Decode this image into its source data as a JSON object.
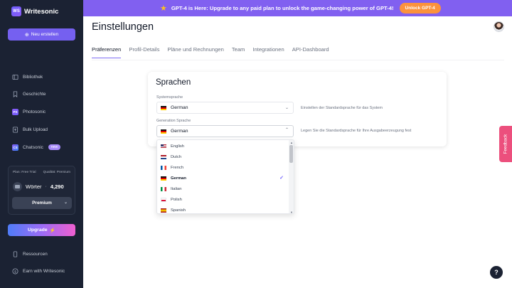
{
  "app": {
    "name": "Writesonic",
    "logo_text": "WS"
  },
  "sidebar": {
    "new_button": "Neu erstellen",
    "items": [
      {
        "label": "Bibliothek",
        "icon": "library-icon"
      },
      {
        "label": "Geschichte",
        "icon": "bookmark-icon"
      },
      {
        "label": "Photosonic",
        "icon": "photosonic-icon"
      },
      {
        "label": "Bulk Upload",
        "icon": "upload-icon"
      },
      {
        "label": "Chatsonic",
        "icon": "chatsonic-icon",
        "badge": "new"
      }
    ],
    "plan": {
      "plan_label": "Plan: Free Trial",
      "quality_label": "Qualität: Premium",
      "words_label": "Wörter",
      "words_count": "4,290",
      "quality_select": "Premium"
    },
    "upgrade_button": "Upgrade",
    "bottom_items": [
      {
        "label": "Ressourcen",
        "icon": "phone-icon"
      },
      {
        "label": "Earn with Writesonic",
        "icon": "dollar-icon"
      }
    ]
  },
  "banner": {
    "text": "GPT-4 is Here: Upgrade to any paid plan to unlock the game-changing power of GPT-4!",
    "button": "Unlock GPT-4"
  },
  "page": {
    "title": "Einstellungen",
    "tabs": [
      "Präferenzen",
      "Profil-Details",
      "Pläne und Rechnungen",
      "Team",
      "Integrationen",
      "API-Dashboard"
    ],
    "active_tab": "Präferenzen"
  },
  "languages": {
    "title": "Sprachen",
    "system_label": "Systemsprache",
    "system_value": "German",
    "system_help": "Einstellen der Standardsprache für das System",
    "generation_label": "Generation Sprache",
    "generation_value": "German",
    "generation_help": "Legen Sie die Standardsprache für Ihre Ausgabeerzeugung fest",
    "options": [
      {
        "label": "English",
        "flag": "us"
      },
      {
        "label": "Dutch",
        "flag": "nl"
      },
      {
        "label": "French",
        "flag": "fr"
      },
      {
        "label": "German",
        "flag": "de",
        "selected": true
      },
      {
        "label": "Italian",
        "flag": "it"
      },
      {
        "label": "Polish",
        "flag": "pl"
      },
      {
        "label": "Spanish",
        "flag": "es"
      }
    ]
  },
  "feedback_tab": "Feedback",
  "help_button": "?",
  "colors": {
    "accent": "#7560f0",
    "sidebar_bg": "#1b2233",
    "banner_bg": "#8160f0",
    "unlock_btn": "#fb923c",
    "feedback": "#ec4f7d"
  }
}
